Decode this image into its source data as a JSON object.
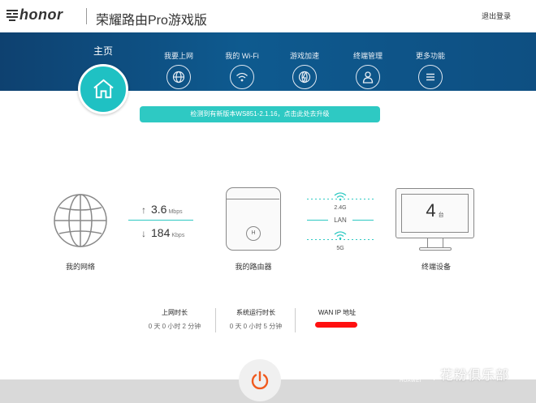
{
  "header": {
    "brand_small": "荣耀",
    "brand": "honor",
    "title": "荣耀路由Pro游戏版",
    "logout": "退出登录"
  },
  "nav": {
    "home_label": "主页",
    "items": [
      {
        "label": "我要上网",
        "icon": "globe-icon"
      },
      {
        "label": "我的 Wi-Fi",
        "icon": "wifi-icon"
      },
      {
        "label": "游戏加速",
        "icon": "game-accel-icon"
      },
      {
        "label": "终端管理",
        "icon": "user-icon"
      },
      {
        "label": "更多功能",
        "icon": "menu-icon"
      }
    ]
  },
  "notice": "检测到有新版本WS851-2.1.16，点击此处去升级",
  "status": {
    "internet_label": "我的网络",
    "upload": {
      "value": "3.6",
      "unit": "Mbps",
      "arrow": "↑"
    },
    "download": {
      "value": "184",
      "unit": "Kbps",
      "arrow": "↓"
    },
    "router_label": "我的路由器",
    "router_badge": "H",
    "conn_24g": "2.4G",
    "conn_lan": "LAN",
    "conn_5g": "5G",
    "devices_count": "4",
    "devices_unit": "台",
    "devices_label": "终端设备"
  },
  "stats": [
    {
      "label": "上网时长",
      "value": "0 天 0 小时 2 分钟"
    },
    {
      "label": "系统运行时长",
      "value": "0 天 0 小时 5 分钟"
    },
    {
      "label": "WAN IP 地址",
      "value": ""
    }
  ],
  "watermark": {
    "brand": "HUAWEI",
    "club": "花粉俱乐部"
  },
  "colors": {
    "nav_bg": "#0e4f82",
    "accent": "#2ec9c3",
    "redaction": "#ff1010",
    "power": "#f05a1e"
  }
}
